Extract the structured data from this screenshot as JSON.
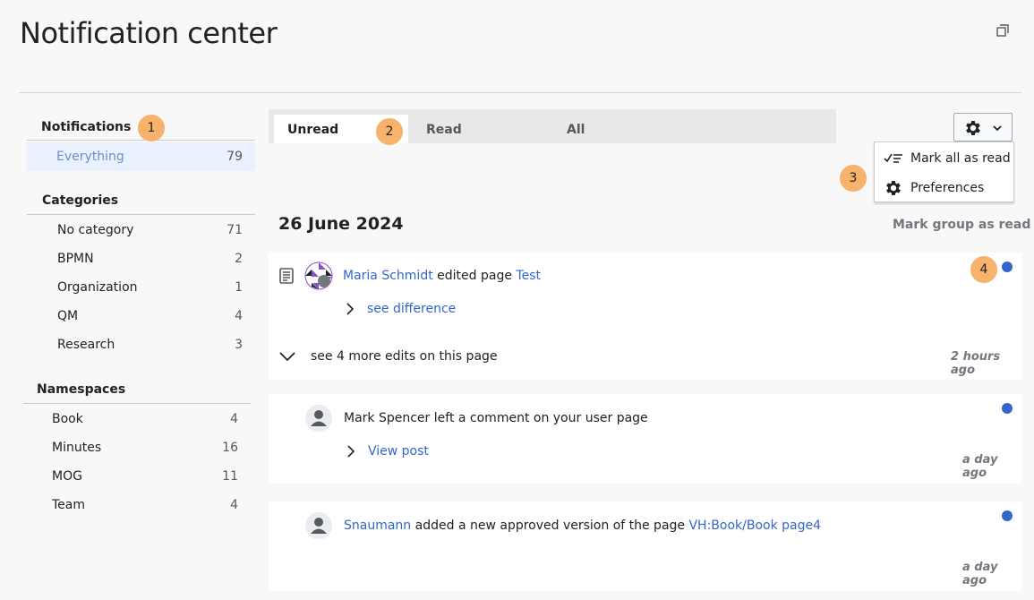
{
  "header": {
    "title": "Notification center"
  },
  "sidebar": {
    "notifications_heading": "Notifications",
    "everything": {
      "label": "Everything",
      "count": "79"
    },
    "categories_heading": "Categories",
    "categories": [
      {
        "label": "No category",
        "count": "71"
      },
      {
        "label": "BPMN",
        "count": "2"
      },
      {
        "label": "Organization",
        "count": "1"
      },
      {
        "label": "QM",
        "count": "4"
      },
      {
        "label": "Research",
        "count": "3"
      }
    ],
    "namespaces_heading": "Namespaces",
    "namespaces": [
      {
        "label": "Book",
        "count": "4"
      },
      {
        "label": "Minutes",
        "count": "16"
      },
      {
        "label": "MOG",
        "count": "11"
      },
      {
        "label": "Team",
        "count": "4"
      }
    ]
  },
  "badges": [
    "1",
    "2",
    "3",
    "4"
  ],
  "tabs": {
    "unread": "Unread",
    "read": "Read",
    "all": "All"
  },
  "menu": {
    "mark_all": "Mark all as read",
    "preferences": "Preferences"
  },
  "group": {
    "date": "26 June 2024",
    "mark_group": "Mark group as read"
  },
  "notifications": [
    {
      "user": "Maria Schmidt",
      "action": "edited page",
      "target": "Test",
      "link": "see difference",
      "more": "see 4 more edits on this page",
      "time": "2 hours ago"
    },
    {
      "user": "Mark Spencer",
      "action": "left a comment on your user page",
      "link": "View post",
      "time": "a day ago"
    },
    {
      "user": "Snaumann",
      "action": "added a new approved version of the page",
      "target": "VH:Book/Book page4",
      "time": "a day ago"
    }
  ],
  "colors": {
    "link": "#3366cc",
    "badge": "#f7b36b",
    "unread_dot": "#3366cc",
    "selected_bg": "#eaf1fe"
  },
  "icons": [
    "expand-icon",
    "gear-icon",
    "chevron-down-icon",
    "mark-read-icon",
    "page-icon",
    "chevron-right-icon",
    "user-avatar-icon"
  ]
}
